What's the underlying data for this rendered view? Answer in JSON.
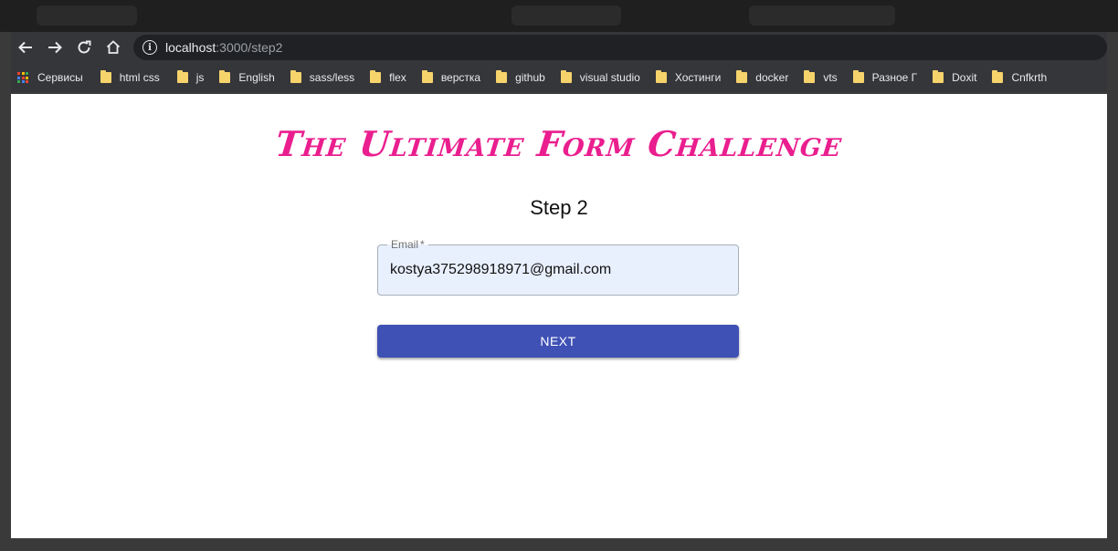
{
  "browser": {
    "url_host": "localhost",
    "url_rest": ":3000/step2"
  },
  "bookmarks": {
    "apps_label": "Сервисы",
    "items": [
      "html css",
      "js",
      "English",
      "sass/less",
      "flex",
      "верстка",
      "github",
      "visual studio",
      "Хостинги",
      "docker",
      "vts",
      "Разное Г",
      "Doxit",
      "Cnfkrth"
    ]
  },
  "page": {
    "title": "The Ultimate Form Challenge",
    "step_heading": "Step 2",
    "email_label": "Email",
    "email_required_mark": "*",
    "email_value": "kostya375298918971@gmail.com",
    "next_label": "NEXT"
  },
  "colors": {
    "title": "#ea1e8e",
    "primary_button": "#3f51b5",
    "autofill_bg": "#e8f0fe"
  }
}
